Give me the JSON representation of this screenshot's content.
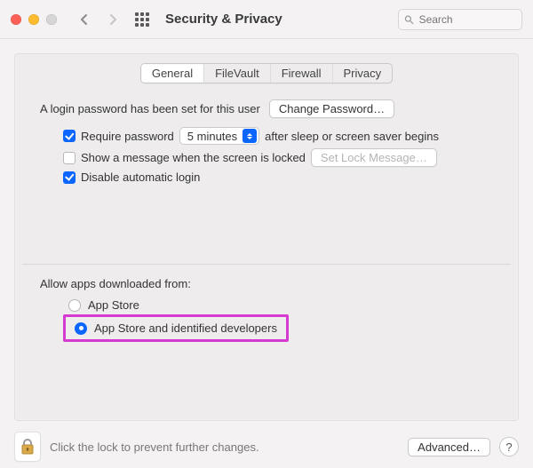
{
  "header": {
    "title": "Security & Privacy",
    "search_placeholder": "Search"
  },
  "tabs": {
    "general": "General",
    "filevault": "FileVault",
    "firewall": "Firewall",
    "privacy": "Privacy",
    "active": "general"
  },
  "login": {
    "password_set_label": "A login password has been set for this user",
    "change_password_button": "Change Password…",
    "require_password": {
      "checked": true,
      "label_before": "Require password",
      "delay_value": "5 minutes",
      "label_after": "after sleep or screen saver begins"
    },
    "show_message": {
      "checked": false,
      "label": "Show a message when the screen is locked",
      "set_lock_msg_button": "Set Lock Message…",
      "set_lock_msg_enabled": false
    },
    "disable_auto_login": {
      "checked": true,
      "label": "Disable automatic login"
    }
  },
  "allow_apps": {
    "heading": "Allow apps downloaded from:",
    "options": {
      "app_store": "App Store",
      "app_store_dev": "App Store and identified developers"
    },
    "selected": "app_store_dev"
  },
  "footer": {
    "lock_message": "Click the lock to prevent further changes.",
    "advanced_button": "Advanced…",
    "help_label": "?"
  }
}
